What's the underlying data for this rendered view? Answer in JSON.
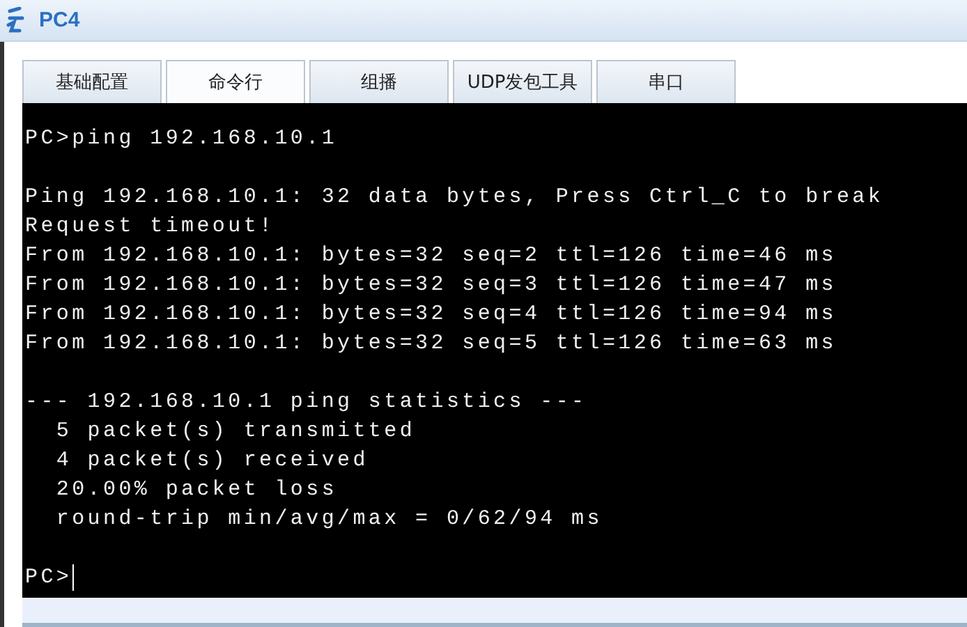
{
  "window": {
    "title": "PC4"
  },
  "tabs": [
    {
      "label": "基础配置",
      "selected": false
    },
    {
      "label": "命令行",
      "selected": true
    },
    {
      "label": "组播",
      "selected": false
    },
    {
      "label": "UDP发包工具",
      "selected": false
    },
    {
      "label": "串口",
      "selected": false
    }
  ],
  "terminal": {
    "blocks": [
      [
        "PC>ping 192.168.10.1"
      ],
      [
        "Ping 192.168.10.1: 32 data bytes, Press Ctrl_C to break",
        "Request timeout!",
        "From 192.168.10.1: bytes=32 seq=2 ttl=126 time=46 ms",
        "From 192.168.10.1: bytes=32 seq=3 ttl=126 time=47 ms",
        "From 192.168.10.1: bytes=32 seq=4 ttl=126 time=94 ms",
        "From 192.168.10.1: bytes=32 seq=5 ttl=126 time=63 ms"
      ],
      [
        "--- 192.168.10.1 ping statistics ---",
        "  5 packet(s) transmitted",
        "  4 packet(s) received",
        "  20.00% packet loss",
        "  round-trip min/avg/max = 0/62/94 ms"
      ]
    ],
    "prompt": "PC>"
  }
}
